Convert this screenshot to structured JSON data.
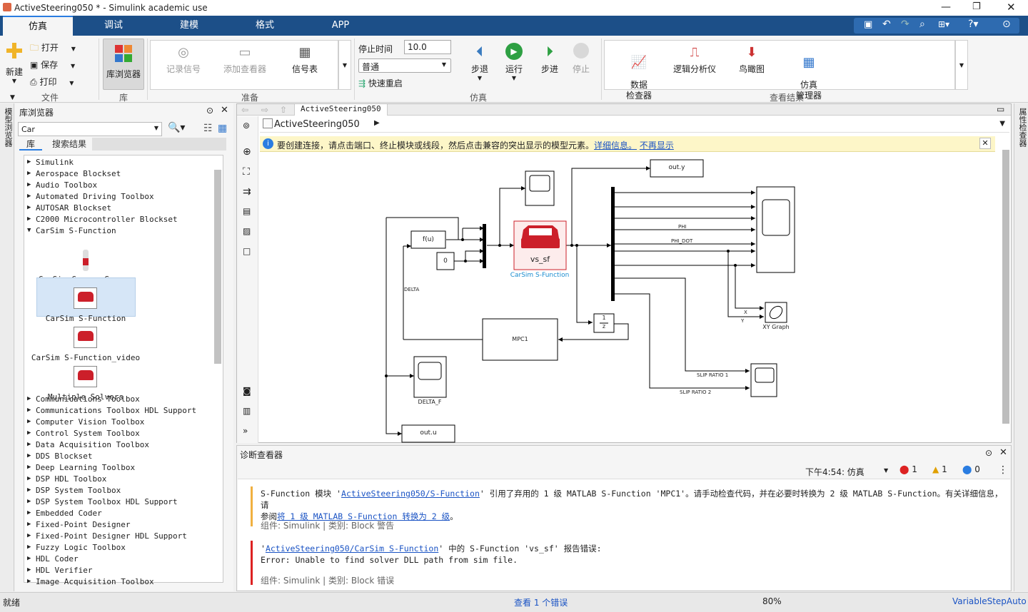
{
  "window": {
    "title": "ActiveSteering050 * - Simulink academic use"
  },
  "tabs": [
    "仿真",
    "调试",
    "建模",
    "格式",
    "APP"
  ],
  "ribbon": {
    "file": {
      "new": "新建",
      "open": "打开",
      "save": "保存",
      "print": "打印",
      "label": "文件"
    },
    "library": {
      "browser": "库浏览器",
      "label": "库"
    },
    "prepare": {
      "record": "记录信号",
      "add_viewer": "添加查看器",
      "signal_table": "信号表",
      "label": "准备"
    },
    "simulate": {
      "stop_time_label": "停止时间",
      "stop_time": "10.0",
      "mode": "普通",
      "fast_restart": "快速重启",
      "step_back": "步退",
      "run": "运行",
      "step_forward": "步进",
      "stop": "停止",
      "label": "仿真"
    },
    "review": {
      "data_inspector": "数据\n检查器",
      "logic_analyzer": "逻辑分析仪",
      "birds_eye": "鸟瞰图",
      "sim_manager": "仿真\n管理器",
      "label": "查看结果"
    }
  },
  "left_rail": {
    "model_browser": "模型浏览器"
  },
  "right_rail": {
    "property_inspector": "属性检查器"
  },
  "library_browser": {
    "title": "库浏览器",
    "search_value": "Car",
    "tabs": [
      "库",
      "搜索结果"
    ],
    "items_before": [
      "Simulink",
      "Aerospace Blockset",
      "Audio Toolbox",
      "Automated Driving Toolbox",
      "AUTOSAR Blockset",
      "C2000 Microcontroller Blockset"
    ],
    "expanded": "CarSim S-Function",
    "blocks": [
      "CarSim Camera Sensor",
      "CarSim S-Function",
      "CarSim S-Function_video",
      "Multiple Solvers"
    ],
    "items_after": [
      "Communications Toolbox",
      "Communications Toolbox HDL Support",
      "Computer Vision Toolbox",
      "Control System Toolbox",
      "Data Acquisition Toolbox",
      "DDS Blockset",
      "Deep Learning Toolbox",
      "DSP HDL Toolbox",
      "DSP System Toolbox",
      "DSP System Toolbox HDL Support",
      "Embedded Coder",
      "Fixed-Point Designer",
      "Fixed-Point Designer HDL Support",
      "Fuzzy Logic Toolbox",
      "HDL Coder",
      "HDL Verifier",
      "Image Acquisition Toolbox"
    ]
  },
  "canvas": {
    "tab": "ActiveSteering050",
    "breadcrumb": "ActiveSteering050",
    "notice": "要创建连接，请点击端口、终止模块或线段，然后点击兼容的突出显示的模型元素。",
    "notice_link1": "详细信息。",
    "notice_link2": "不再显示",
    "blocks": {
      "fcn": "f(u)",
      "const": "0",
      "carsim_text": "vs_sf",
      "carsim_label": "CarSim S-Function",
      "mpc": "MPC1",
      "integ_num": "1",
      "integ_den": "z",
      "outy": "out.y",
      "outu": "out.u",
      "delta_f": "DELTA_F",
      "xy_graph": "XY Graph",
      "delta": "DELTA",
      "phi": "PHI",
      "phi_dot": "PHI_DOT",
      "x": "X",
      "y": "Y",
      "slip1": "SLIP RATIO 1",
      "slip2": "SLIP RATIO 2"
    }
  },
  "diagnostics": {
    "title": "诊断查看器",
    "time_filter": "下午4:54: 仿真",
    "errors": "1",
    "warnings": "1",
    "infos": "0",
    "msg1_pre": "S-Function 模块 '",
    "msg1_link": "ActiveSteering050/S-Function",
    "msg1_mid": "' 引用了弃用的 1 级 MATLAB S-Function 'MPC1'。请手动检查代码，并在必要时转换为 2 级 MATLAB S-Function。有关详细信息，请",
    "msg1_pre2": "参阅",
    "msg1_link2": "将 1 级 MATLAB S-Function 转换为 2 级",
    "msg1_end": "。",
    "msg1_meta": "组件: Simulink | 类别: Block 警告",
    "msg2_q": "'",
    "msg2_link": "ActiveSteering050/CarSim S-Function",
    "msg2_mid": "' 中的 S-Function 'vs_sf' 报告错误:",
    "msg2_line2": "Error: Unable to find solver DLL path from sim file.",
    "msg2_meta": "组件: Simulink | 类别: Block 错误"
  },
  "statusbar": {
    "left": "就绪",
    "center": "查看 1 个错误",
    "zoom": "80%",
    "solver": "VariableStepAuto"
  },
  "colors": {
    "accent": "#1c4f88",
    "carsim_red": "#cc1f2a",
    "warning_bar": "#fdf6c8"
  }
}
